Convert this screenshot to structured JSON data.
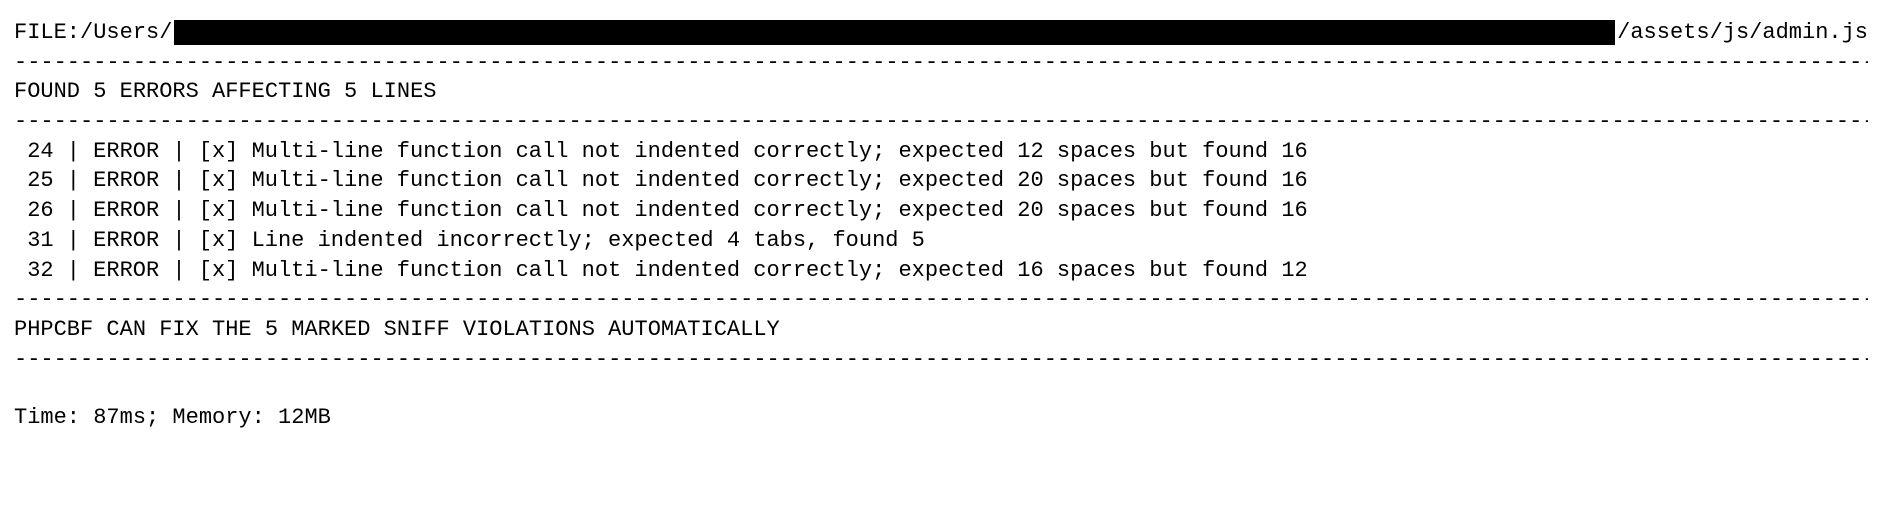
{
  "file": {
    "prefix_label": "FILE: ",
    "path_prefix": "/Users/",
    "path_suffix": "/assets/js/admin.js"
  },
  "summary": "FOUND 5 ERRORS AFFECTING 5 LINES",
  "errors": [
    {
      "line": "24",
      "type": "ERROR",
      "marker": "[x]",
      "message": "Multi-line function call not indented correctly; expected 12 spaces but found 16"
    },
    {
      "line": "25",
      "type": "ERROR",
      "marker": "[x]",
      "message": "Multi-line function call not indented correctly; expected 20 spaces but found 16"
    },
    {
      "line": "26",
      "type": "ERROR",
      "marker": "[x]",
      "message": "Multi-line function call not indented correctly; expected 20 spaces but found 16"
    },
    {
      "line": "31",
      "type": "ERROR",
      "marker": "[x]",
      "message": "Line indented incorrectly; expected 4 tabs, found 5"
    },
    {
      "line": "32",
      "type": "ERROR",
      "marker": "[x]",
      "message": "Multi-line function call not indented correctly; expected 16 spaces but found 12"
    }
  ],
  "fix_note": "PHPCBF CAN FIX THE 5 MARKED SNIFF VIOLATIONS AUTOMATICALLY",
  "stats": "Time: 87ms; Memory: 12MB",
  "divider": "----------------------------------------------------------------------------------------------------------------------------------------------------------",
  "sep": "|"
}
